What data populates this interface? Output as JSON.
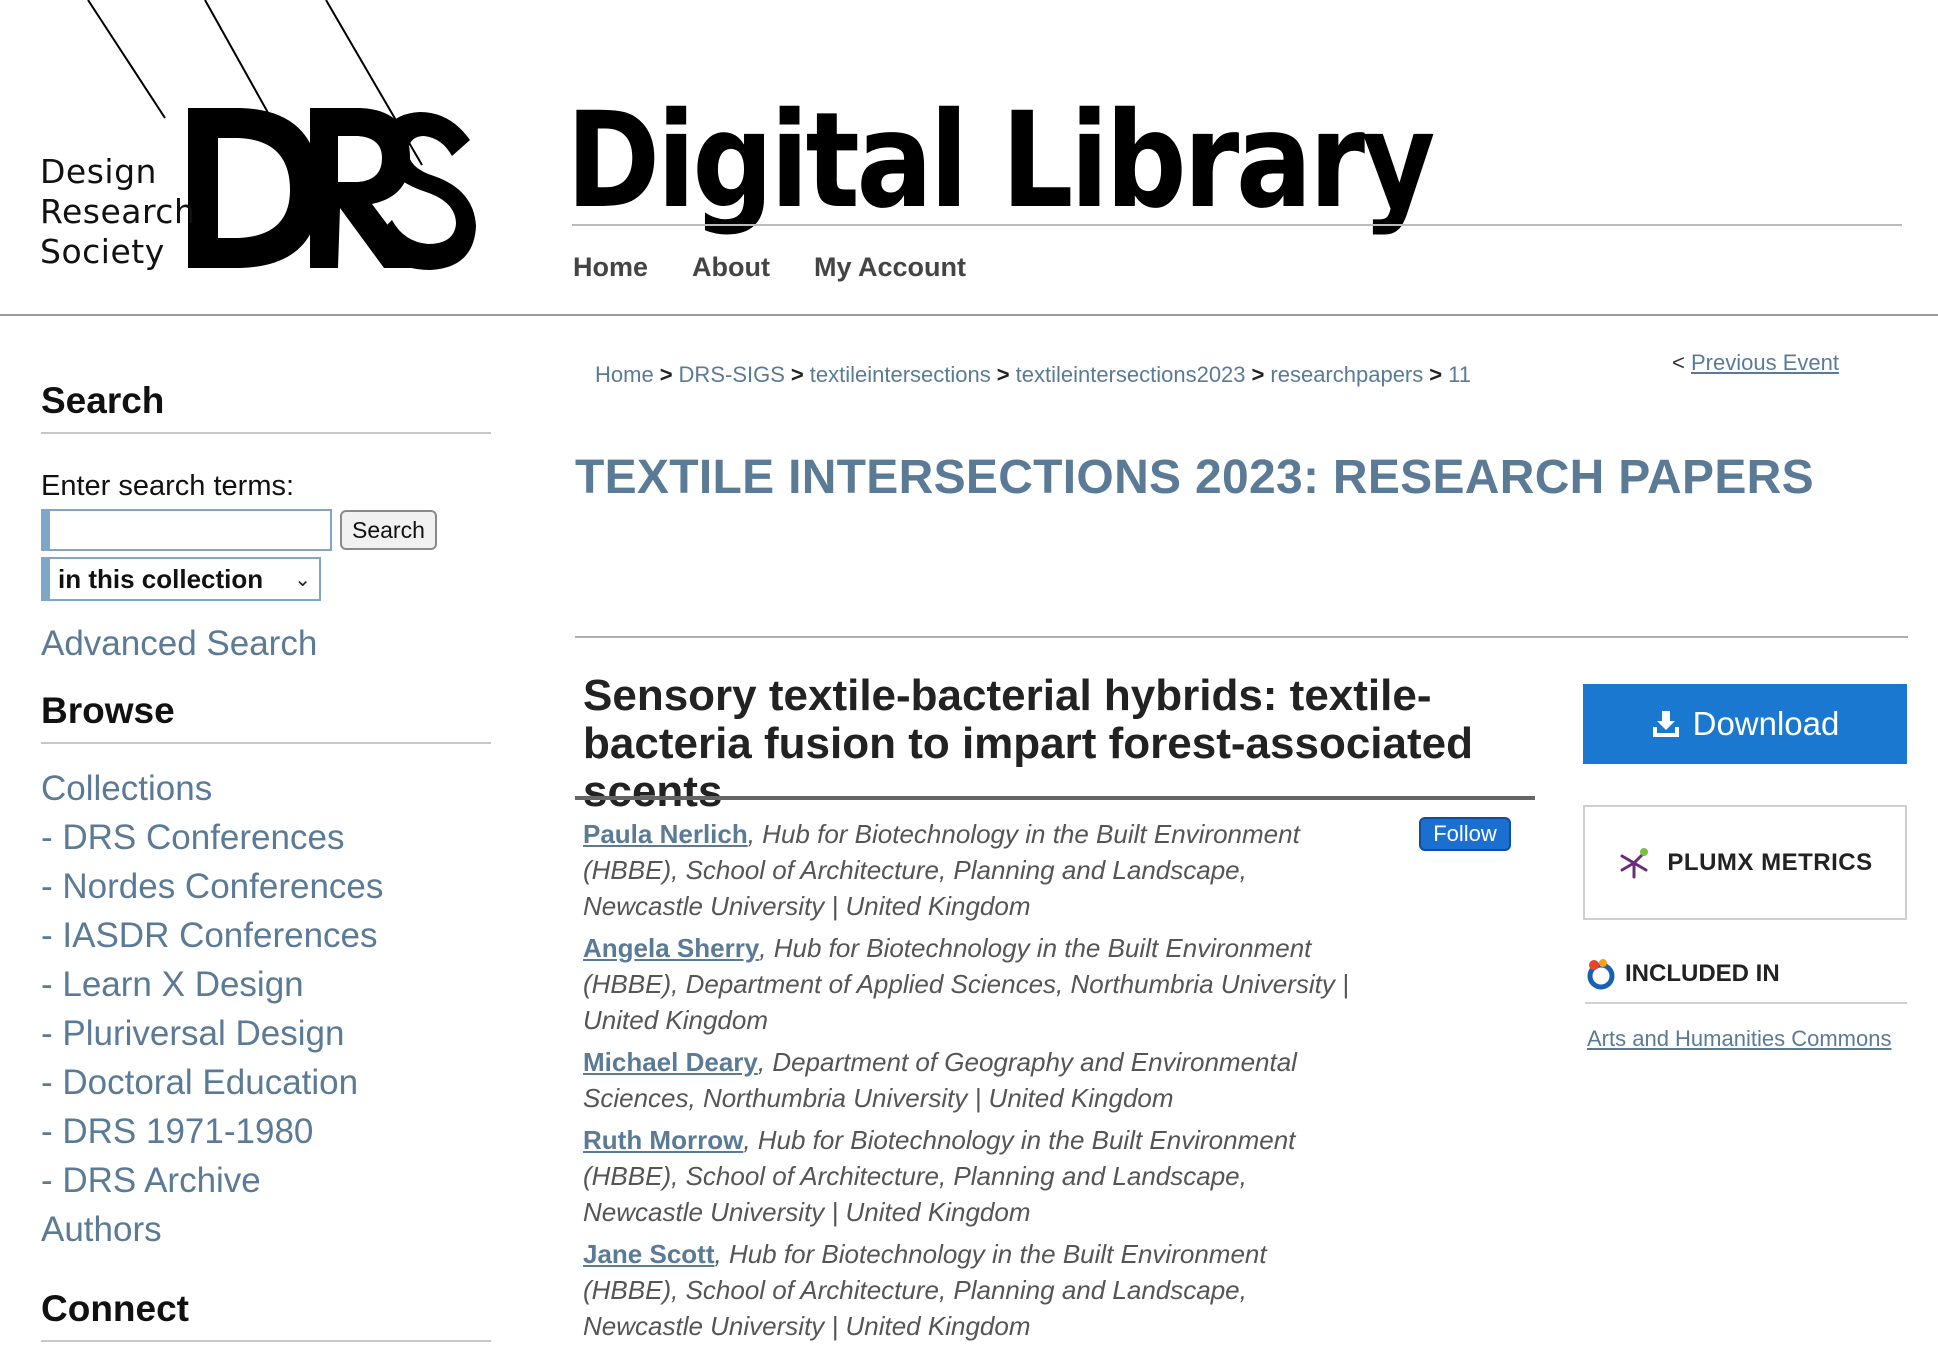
{
  "brand": {
    "logo_lines": [
      "Design",
      "Research",
      "Society"
    ],
    "site_title": "Digital Library"
  },
  "nav": {
    "items": [
      "Home",
      "About",
      "My Account"
    ]
  },
  "sidebar": {
    "search_heading": "Search",
    "search_label": "Enter search terms:",
    "search_value": "",
    "search_button": "Search",
    "scope_selected": "in this collection",
    "advanced_search": "Advanced Search",
    "browse_heading": "Browse",
    "browse_items": [
      "Collections",
      "- DRS Conferences",
      "- Nordes Conferences",
      "- IASDR Conferences",
      "- Learn X Design",
      "- Pluriversal Design",
      "- Doctoral Education",
      "- DRS 1971-1980",
      "- DRS Archive",
      "Authors"
    ],
    "connect_heading": "Connect"
  },
  "breadcrumb": {
    "items": [
      "Home",
      "DRS-SIGS",
      "textileintersections",
      "textileintersections2023",
      "researchpapers",
      "11"
    ],
    "separator": ">"
  },
  "prev_event": {
    "prefix": "<",
    "label": "Previous Event"
  },
  "collection_title": "TEXTILE INTERSECTIONS 2023: RESEARCH PAPERS",
  "article": {
    "title": "Sensory textile-bacterial hybrids: textile-bacteria fusion to impart forest-associated scents",
    "follow_label": "Follow",
    "authors": [
      {
        "name": "Paula Nerlich",
        "affiliation": ", Hub for Biotechnology in the Built Environment (HBBE), School of Architecture, Planning and Landscape, Newcastle University | United Kingdom"
      },
      {
        "name": "Angela Sherry",
        "affiliation": ", Hub for Biotechnology in the Built Environment (HBBE), Department of Applied Sciences, Northumbria University | United Kingdom"
      },
      {
        "name": "Michael Deary",
        "affiliation": ", Department of Geography and Environmental Sciences, Northumbria University | United Kingdom"
      },
      {
        "name": "Ruth Morrow",
        "affiliation": ", Hub for Biotechnology in the Built Environment (HBBE), School of Architecture, Planning and Landscape, Newcastle University | United Kingdom"
      },
      {
        "name": "Jane Scott",
        "affiliation": ", Hub for Biotechnology in the Built Environment (HBBE), School of Architecture, Planning and Landscape, Newcastle University | United Kingdom"
      }
    ]
  },
  "right": {
    "download_label": "Download",
    "plumx_label": "PLUMX METRICS",
    "included_label": "INCLUDED IN",
    "commons_link": "Arts and Humanities Commons"
  },
  "colors": {
    "link": "#5b7a96",
    "download_bg": "#1b78d0",
    "follow_bg": "#1b6fd0"
  }
}
